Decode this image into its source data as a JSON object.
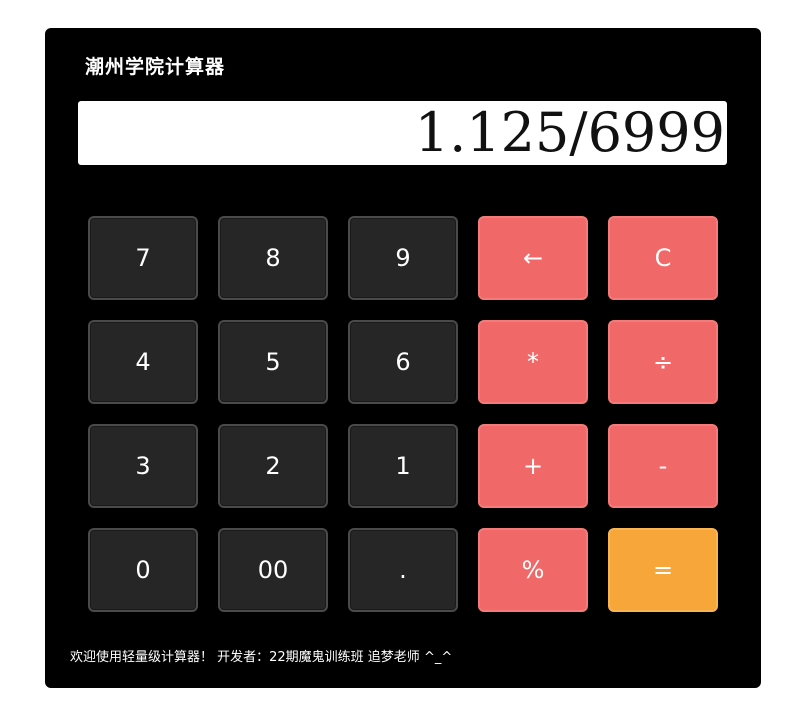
{
  "app": {
    "title": "潮州学院计算器"
  },
  "display": {
    "value": "1.125/6999"
  },
  "keys": [
    {
      "label": "7",
      "name": "key-7",
      "kind": "num"
    },
    {
      "label": "8",
      "name": "key-8",
      "kind": "num"
    },
    {
      "label": "9",
      "name": "key-9",
      "kind": "num"
    },
    {
      "label": "←",
      "name": "backspace-button",
      "kind": "op"
    },
    {
      "label": "C",
      "name": "clear-button",
      "kind": "op"
    },
    {
      "label": "4",
      "name": "key-4",
      "kind": "num"
    },
    {
      "label": "5",
      "name": "key-5",
      "kind": "num"
    },
    {
      "label": "6",
      "name": "key-6",
      "kind": "num"
    },
    {
      "label": "*",
      "name": "multiply-button",
      "kind": "op"
    },
    {
      "label": "÷",
      "name": "divide-button",
      "kind": "op"
    },
    {
      "label": "3",
      "name": "key-3",
      "kind": "num"
    },
    {
      "label": "2",
      "name": "key-2",
      "kind": "num"
    },
    {
      "label": "1",
      "name": "key-1",
      "kind": "num"
    },
    {
      "label": "+",
      "name": "add-button",
      "kind": "op"
    },
    {
      "label": "-",
      "name": "subtract-button",
      "kind": "op"
    },
    {
      "label": "0",
      "name": "key-0",
      "kind": "num"
    },
    {
      "label": "00",
      "name": "key-00",
      "kind": "num"
    },
    {
      "label": ".",
      "name": "decimal-point-button",
      "kind": "num"
    },
    {
      "label": "%",
      "name": "percent-button",
      "kind": "op"
    },
    {
      "label": "=",
      "name": "equals-button",
      "kind": "eq"
    }
  ],
  "footer": {
    "text": "欢迎使用轻量级计算器！ 开发者：22期魔鬼训练班 追梦老师 ^_^"
  },
  "colors": {
    "background": "#000000",
    "number_key": "#262626",
    "operator_key": "#f06868",
    "equals_key": "#f7a63a",
    "display": "#ffffff"
  }
}
